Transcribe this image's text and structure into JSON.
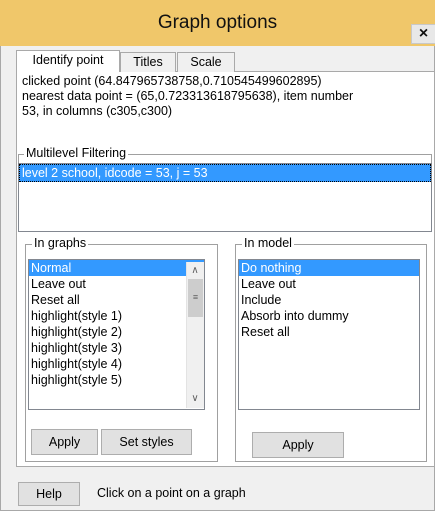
{
  "window": {
    "title": "Graph options",
    "close_label": "×"
  },
  "tabs": [
    "Identify point",
    "Titles",
    "Scale"
  ],
  "info": {
    "line1": "clicked point (64.847965738758,0.710545499602895)",
    "line2": "nearest data point = (65,0.723313618795638), item number",
    "line3": "53, in columns (c305,c300)"
  },
  "multilevel": {
    "legend": "Multilevel Filtering",
    "items": [
      "level 2  school, idcode = 53,   j = 53"
    ]
  },
  "in_graphs": {
    "legend": "In graphs",
    "items": [
      "Normal",
      "Leave out",
      "Reset all",
      "highlight(style 1)",
      "highlight(style 2)",
      "highlight(style 3)",
      "highlight(style 4)",
      "highlight(style 5)"
    ],
    "selected": "Normal",
    "apply_label": "Apply",
    "set_styles_label": "Set styles"
  },
  "in_model": {
    "legend": "In model",
    "items": [
      "Do nothing",
      "Leave out",
      "Include",
      "Absorb into dummy",
      "Reset all"
    ],
    "selected": "Do nothing",
    "apply_label": "Apply"
  },
  "footer": {
    "help_label": "Help",
    "status": "Click on a point on a graph"
  },
  "colors": {
    "titlebar": "#f0c76a",
    "selection": "#3399ff"
  }
}
